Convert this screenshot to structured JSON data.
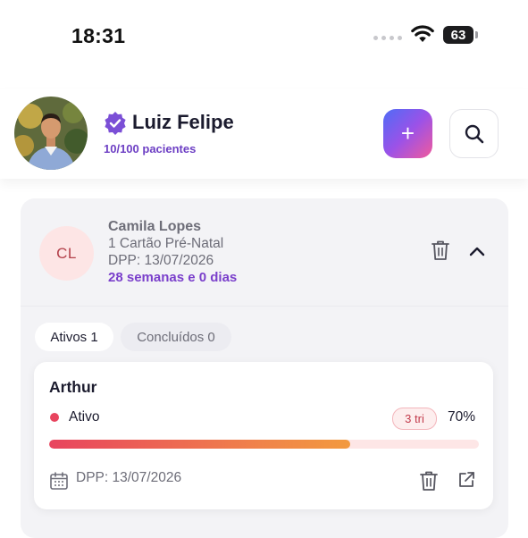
{
  "status_bar": {
    "time": "18:31",
    "battery": "63"
  },
  "header": {
    "user_name": "Luiz Felipe",
    "patients_count": "10/100 pacientes",
    "add_label": "+"
  },
  "patient": {
    "initials": "CL",
    "name": "Camila Lopes",
    "plan": "1 Cartão Pré-Natal",
    "dpp": "DPP: 13/07/2026",
    "gestational_age": "28 semanas e 0 dias"
  },
  "tabs": [
    {
      "label": "Ativos 1"
    },
    {
      "label": "Concluídos 0"
    }
  ],
  "pregnancy": {
    "name": "Arthur",
    "status": "Ativo",
    "trimester": "3 tri",
    "progress_label": "70%",
    "progress_value": 0.7,
    "dpp": "DPP: 13/07/2026"
  },
  "colors": {
    "accent_purple": "#7a3fcb",
    "status_red": "#e8445e",
    "progress_orange": "#f29a3f"
  },
  "icons": {
    "verified": "verified-badge-icon",
    "search": "search-icon",
    "trash": "trash-icon",
    "chevron": "chevron-up-icon",
    "calendar": "calendar-icon",
    "open": "open-external-icon"
  }
}
